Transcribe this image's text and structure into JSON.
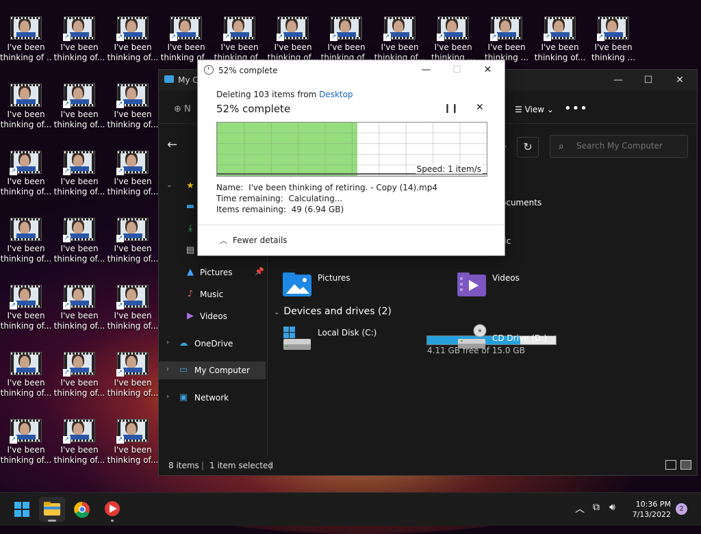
{
  "desktop": {
    "icons": [
      {
        "line1": "I've been",
        "line2": "thinking of ..."
      },
      {
        "line1": "I've been",
        "line2": "thinking of..."
      },
      {
        "line1": "I've been",
        "line2": "thinking of..."
      },
      {
        "line1": "I've been",
        "line2": "thinking of..."
      },
      {
        "line1": "I've been",
        "line2": "thinking of..."
      },
      {
        "line1": "I've been",
        "line2": "thinking of..."
      },
      {
        "line1": "I've been",
        "line2": "thinking of..."
      },
      {
        "line1": "I've been",
        "line2": "thinking of..."
      },
      {
        "line1": "I've been",
        "line2": "thinking ..."
      },
      {
        "line1": "I've been",
        "line2": "thinking ..."
      },
      {
        "line1": "I've been",
        "line2": "thinking of..."
      },
      {
        "line1": "I've been",
        "line2": "thinking ..."
      }
    ],
    "left_column_label": {
      "line1": "I've been",
      "line2": "thinking of..."
    }
  },
  "explorer": {
    "title": "My Computer",
    "toolbar": {
      "new_label": "N",
      "view_label": "View",
      "more_label": "•••"
    },
    "search": {
      "placeholder": "Search My Computer"
    },
    "nav": {
      "quick_access": "C",
      "pictures": "Pictures",
      "music": "Music",
      "videos": "Videos",
      "onedrive": "OneDrive",
      "my_computer": "My Computer",
      "network": "Network"
    },
    "content": {
      "documents_partial": "ocuments",
      "music_partial": "sic",
      "pictures": "Pictures",
      "videos": "Videos",
      "devices_header": "Devices and drives (2)",
      "local_disk": {
        "name": "Local Disk (C:)",
        "free": "4.11 GB free of 15.0 GB",
        "used_fraction": 0.726
      },
      "cd_drive": "CD Drive (D:)"
    },
    "status": {
      "items": "8 items",
      "selected": "1 item selected"
    }
  },
  "dialog": {
    "title": "52% complete",
    "deleting_prefix": "Deleting 103 items from ",
    "deleting_location": "Desktop",
    "percent_text": "52% complete",
    "progress_fraction": 0.52,
    "speed": "Speed: 1 item/s",
    "name_label": "Name:",
    "name_value": "I've been thinking of retiring. - Copy (14).mp4",
    "time_label": "Time remaining:",
    "time_value": "Calculating...",
    "items_label": "Items remaining:",
    "items_value": "49 (6.94 GB)",
    "fewer_details": "Fewer details"
  },
  "taskbar": {
    "time": "10:36 PM",
    "date": "7/13/2022",
    "notifications": "2"
  }
}
